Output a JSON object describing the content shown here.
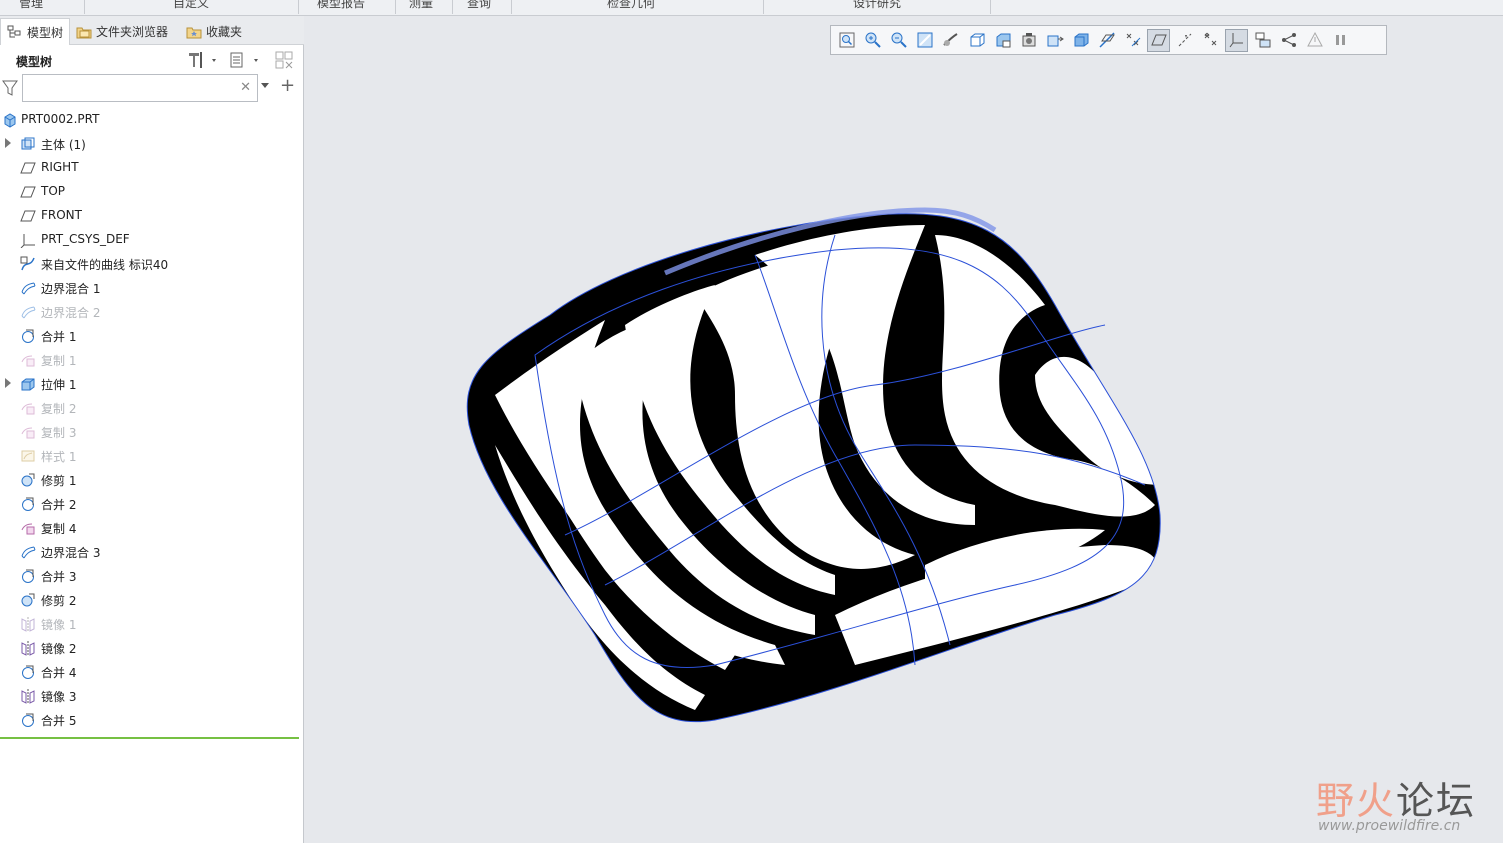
{
  "ribbon": {
    "groups": [
      "管理",
      "自定义",
      "模型报告",
      "测量",
      "查询",
      "检查几何",
      "设计研究"
    ]
  },
  "tabs": [
    {
      "label": "模型树",
      "icon": "model-tree-icon"
    },
    {
      "label": "文件夹浏览器",
      "icon": "folder-browser-icon"
    },
    {
      "label": "收藏夹",
      "icon": "favorites-icon"
    }
  ],
  "tree_header": {
    "title": "模型树"
  },
  "search": {
    "value": "",
    "placeholder": ""
  },
  "tree": [
    {
      "label": "PRT0002.PRT",
      "icon": "part-icon",
      "state": "normal",
      "expandable": false
    },
    {
      "label": "主体 (1)",
      "icon": "body-icon",
      "state": "normal",
      "expandable": true
    },
    {
      "label": "RIGHT",
      "icon": "datum-plane-icon",
      "state": "normal",
      "expandable": false
    },
    {
      "label": "TOP",
      "icon": "datum-plane-icon",
      "state": "normal",
      "expandable": false
    },
    {
      "label": "FRONT",
      "icon": "datum-plane-icon",
      "state": "normal",
      "expandable": false
    },
    {
      "label": "PRT_CSYS_DEF",
      "icon": "coordinate-system-icon",
      "state": "normal",
      "expandable": false
    },
    {
      "label": "来自文件的曲线 标识40",
      "icon": "curve-from-file-icon",
      "state": "normal",
      "expandable": false
    },
    {
      "label": "边界混合 1",
      "icon": "boundary-blend-icon",
      "state": "normal",
      "expandable": false
    },
    {
      "label": "边界混合 2",
      "icon": "boundary-blend-icon",
      "state": "dim",
      "expandable": false
    },
    {
      "label": "合并 1",
      "icon": "merge-icon",
      "state": "normal",
      "expandable": false
    },
    {
      "label": "复制 1",
      "icon": "copy-icon",
      "state": "dim",
      "expandable": false
    },
    {
      "label": "拉伸 1",
      "icon": "extrude-icon",
      "state": "normal",
      "expandable": true
    },
    {
      "label": "复制 2",
      "icon": "copy-icon",
      "state": "dim",
      "expandable": false
    },
    {
      "label": "复制 3",
      "icon": "copy-icon",
      "state": "dim",
      "expandable": false
    },
    {
      "label": "样式 1",
      "icon": "style-icon",
      "state": "dim",
      "expandable": false
    },
    {
      "label": "修剪 1",
      "icon": "trim-icon",
      "state": "normal",
      "expandable": false
    },
    {
      "label": "合并 2",
      "icon": "merge-icon",
      "state": "normal",
      "expandable": false
    },
    {
      "label": "复制 4",
      "icon": "copy-icon",
      "state": "normal",
      "expandable": false
    },
    {
      "label": "边界混合 3",
      "icon": "boundary-blend-icon",
      "state": "normal",
      "expandable": false
    },
    {
      "label": "合并 3",
      "icon": "merge-icon",
      "state": "normal",
      "expandable": false
    },
    {
      "label": "修剪 2",
      "icon": "trim-icon",
      "state": "normal",
      "expandable": false
    },
    {
      "label": "镜像 1",
      "icon": "mirror-icon",
      "state": "dim",
      "expandable": false
    },
    {
      "label": "镜像 2",
      "icon": "mirror-icon",
      "state": "normal",
      "expandable": false
    },
    {
      "label": "合并 4",
      "icon": "merge-icon",
      "state": "normal",
      "expandable": false
    },
    {
      "label": "镜像 3",
      "icon": "mirror-icon",
      "state": "normal",
      "expandable": false
    },
    {
      "label": "合并 5",
      "icon": "merge-icon",
      "state": "normal",
      "expandable": false
    }
  ],
  "view_toolbar": [
    {
      "icon": "refit-icon",
      "active": false
    },
    {
      "icon": "zoom-in-icon",
      "active": false
    },
    {
      "icon": "zoom-out-icon",
      "active": false
    },
    {
      "icon": "repaint-icon",
      "active": false
    },
    {
      "icon": "saved-orientations-icon",
      "active": false
    },
    {
      "icon": "display-style-icon",
      "active": false
    },
    {
      "icon": "saved-views-icon",
      "active": false
    },
    {
      "icon": "perspective-view-icon",
      "active": false
    },
    {
      "icon": "section-icon",
      "active": false
    },
    {
      "icon": "appearance-icon",
      "active": false
    },
    {
      "icon": "datum-display-icon",
      "active": false
    },
    {
      "icon": "point-display-icon",
      "active": false
    },
    {
      "icon": "plane-display-icon",
      "active": true
    },
    {
      "icon": "axis-display-icon",
      "active": false
    },
    {
      "icon": "csys-display-icon",
      "active": false
    },
    {
      "icon": "annotation-display-icon",
      "active": true
    },
    {
      "icon": "spin-center-icon",
      "active": false
    },
    {
      "icon": "analysis-icon",
      "active": false
    },
    {
      "icon": "pause-icon",
      "active": false
    },
    {
      "icon": "stop-icon",
      "active": false
    }
  ],
  "watermark": {
    "title_a": "野火",
    "title_b": "论坛",
    "url": "www.proewildfire.cn"
  },
  "colors": {
    "accent_blue": "#2a73c8",
    "green_line": "#76c043",
    "model_edges": "#2b50d8"
  }
}
